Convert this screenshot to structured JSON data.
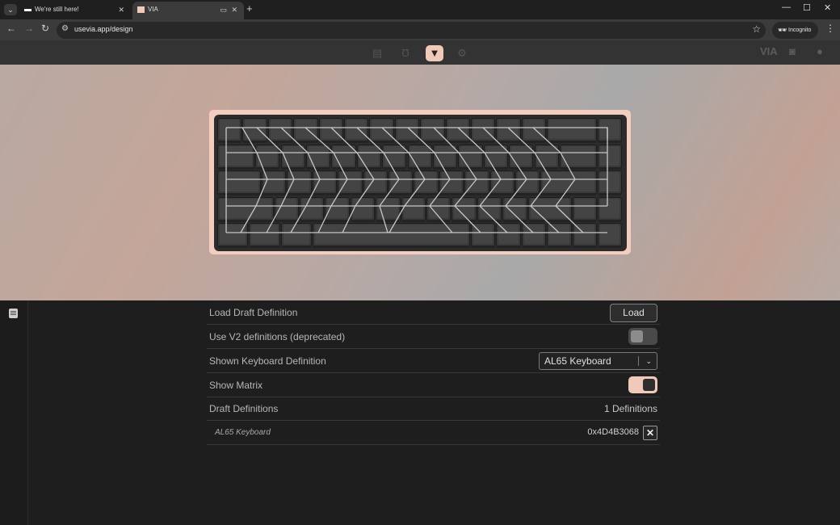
{
  "browser": {
    "tabs": [
      {
        "title": "We're still here!",
        "active": false
      },
      {
        "title": "VIA",
        "active": true
      }
    ],
    "url": "usevia.app/design",
    "incognito_label": "Incognito"
  },
  "via": {
    "header_icons": [
      "keyboard-icon",
      "magnet-icon",
      "paintbrush-icon",
      "gear-icon"
    ],
    "active_icon": "paintbrush-icon",
    "brand": "VIA",
    "right_icons": [
      "discord-icon",
      "github-icon"
    ]
  },
  "keyboard": {
    "case_color": "#f3cdbd",
    "plate_color": "#2c2c2c"
  },
  "settings": {
    "load_draft": {
      "label": "Load Draft Definition",
      "button": "Load"
    },
    "use_v2": {
      "label": "Use V2 definitions (deprecated)",
      "enabled": false
    },
    "shown_definition": {
      "label": "Shown Keyboard Definition",
      "value": "AL65 Keyboard"
    },
    "show_matrix": {
      "label": "Show Matrix",
      "enabled": true
    },
    "draft_definitions": {
      "label": "Draft Definitions",
      "count": "1 Definitions"
    },
    "definitions": [
      {
        "name": "AL65 Keyboard",
        "id": "0x4D4B3068",
        "remove": "✕"
      }
    ]
  },
  "colors": {
    "accent": "#f0c9b9",
    "panel_bg": "#1e1e1e",
    "header_bg": "#333333"
  }
}
